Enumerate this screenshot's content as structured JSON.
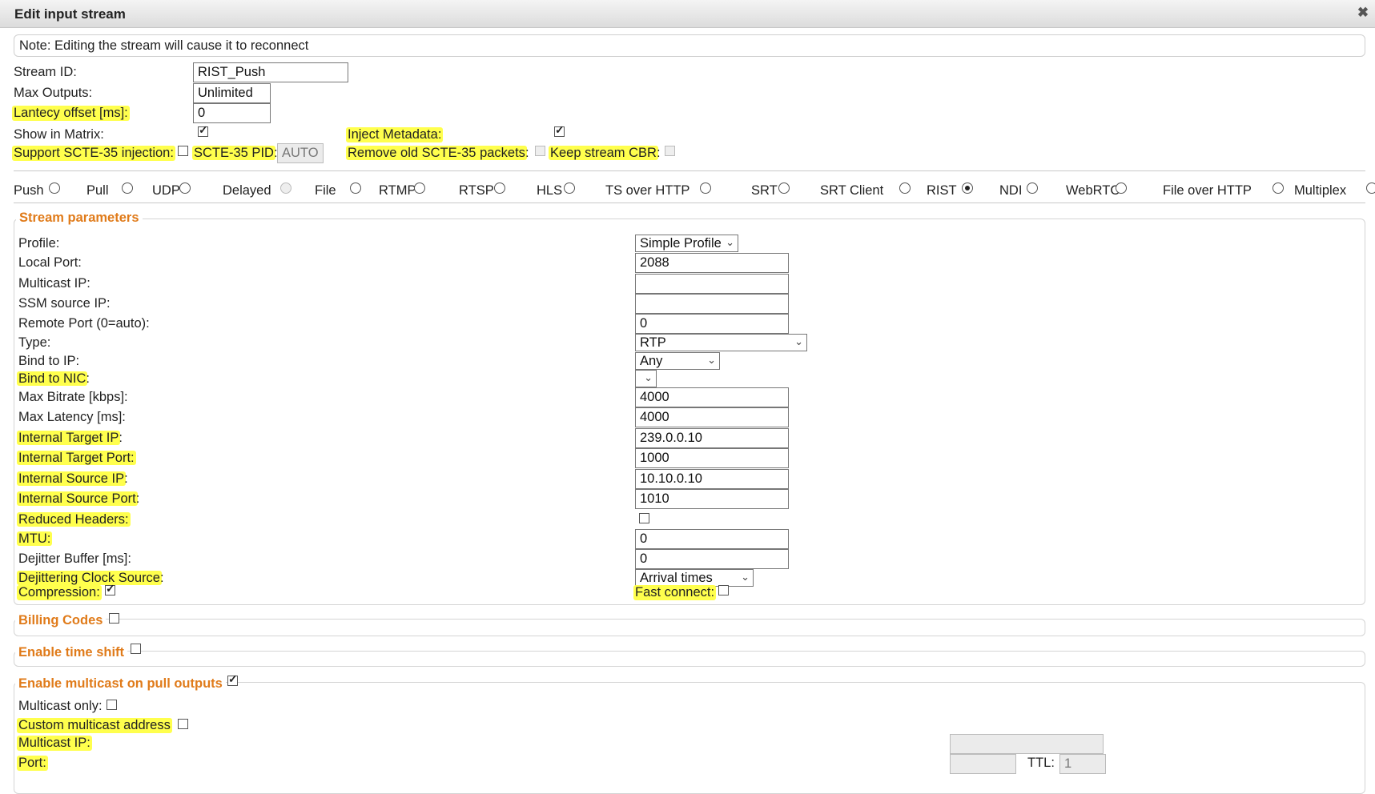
{
  "dialog": {
    "title": "Edit input stream",
    "close_icon": "close-icon"
  },
  "note": "Note: Editing the stream will cause it to reconnect",
  "general": {
    "stream_id_label": "Stream ID:",
    "stream_id_value": "RIST_Push",
    "max_outputs_label": "Max Outputs:",
    "max_outputs_value": "Unlimited",
    "latency_label": "Lantecy offset [ms]:",
    "latency_value": "0",
    "show_in_matrix_label": "Show in Matrix:",
    "show_in_matrix": true,
    "inject_metadata_label": "Inject Metadata:",
    "inject_metadata": true,
    "scte35_label": "Support SCTE-35 injection:",
    "scte35": false,
    "scte35_pid_label": "SCTE-35 PID",
    "scte35_pid_colon": ":",
    "scte35_pid_value": "AUTO",
    "remove_scte35_label": "Remove old SCTE-35 packets",
    "remove_scte35_colon": ":",
    "keep_cbr_label": "Keep stream CBR",
    "keep_cbr_colon": ":"
  },
  "stream_types": [
    {
      "label": "Push",
      "selected": false
    },
    {
      "label": "Pull",
      "selected": false
    },
    {
      "label": "UDP",
      "selected": false
    },
    {
      "label": "Delayed",
      "selected": false,
      "disabled": true
    },
    {
      "label": "File",
      "selected": false
    },
    {
      "label": "RTMP",
      "selected": false
    },
    {
      "label": "RTSP",
      "selected": false
    },
    {
      "label": "HLS",
      "selected": false
    },
    {
      "label": "TS over HTTP",
      "selected": false
    },
    {
      "label": "SRT",
      "selected": false
    },
    {
      "label": "SRT Client",
      "selected": false
    },
    {
      "label": "RIST",
      "selected": true
    },
    {
      "label": "NDI",
      "selected": false
    },
    {
      "label": "WebRTC",
      "selected": false
    },
    {
      "label": "File over HTTP",
      "selected": false
    },
    {
      "label": "Multiplex",
      "selected": false
    }
  ],
  "stream_params": {
    "legend": "Stream parameters",
    "rows": [
      {
        "label": "Profile:",
        "kind": "select",
        "value": "Simple Profile"
      },
      {
        "label": "Local Port:",
        "kind": "text",
        "value": "2088"
      },
      {
        "label": "Multicast IP:",
        "kind": "text",
        "value": ""
      },
      {
        "label": "SSM source IP:",
        "kind": "text",
        "value": ""
      },
      {
        "label": "Remote Port (0=auto):",
        "kind": "text",
        "value": "0"
      },
      {
        "label": "Type:",
        "kind": "select",
        "value": "RTP"
      },
      {
        "label": "Bind to IP:",
        "kind": "select",
        "value": "Any"
      },
      {
        "label": "Bind to NIC",
        "suffix": ":",
        "highlight": true,
        "kind": "select",
        "value": ""
      },
      {
        "label": "Max Bitrate [kbps]:",
        "kind": "text",
        "value": "4000"
      },
      {
        "label": "Max Latency [ms]:",
        "kind": "text",
        "value": "4000"
      },
      {
        "label": "Internal Target IP",
        "suffix": ":",
        "highlight": true,
        "kind": "text",
        "value": "239.0.0.10"
      },
      {
        "label": "Internal Target Port:",
        "highlight": true,
        "kind": "text",
        "value": "1000"
      },
      {
        "label": "Internal Source IP",
        "suffix": ":",
        "highlight": true,
        "kind": "text",
        "value": "10.10.0.10"
      },
      {
        "label": "Internal Source Port",
        "suffix": ":",
        "highlight": true,
        "kind": "text",
        "value": "1010"
      },
      {
        "label": "Reduced Headers:",
        "highlight": true,
        "kind": "checkbox",
        "value": false
      },
      {
        "label": "MTU:",
        "highlight": true,
        "kind": "text",
        "value": "0"
      },
      {
        "label": "Dejitter Buffer [ms]:",
        "kind": "text",
        "value": "0"
      },
      {
        "label": "Dejittering Clock Source",
        "suffix": ":",
        "highlight": true,
        "kind": "select",
        "value": "Arrival times"
      }
    ],
    "compression_label": "Compression:",
    "compression": true,
    "fast_connect_label": "Fast connect:",
    "fast_connect": false
  },
  "billing": {
    "label": "Billing Codes",
    "checked": false
  },
  "time_shift": {
    "label": "Enable time shift",
    "checked": false
  },
  "multicast_pull": {
    "label": "Enable multicast on pull outputs",
    "checked": true,
    "multicast_only_label": "Multicast only:",
    "multicast_only": false,
    "custom_address_label": "Custom multicast address",
    "custom_address": false,
    "multicast_ip_label": "Multicast IP:",
    "multicast_ip_value": "",
    "port_label": "Port:",
    "port_value": "",
    "ttl_label": "TTL:",
    "ttl_value": "1"
  }
}
